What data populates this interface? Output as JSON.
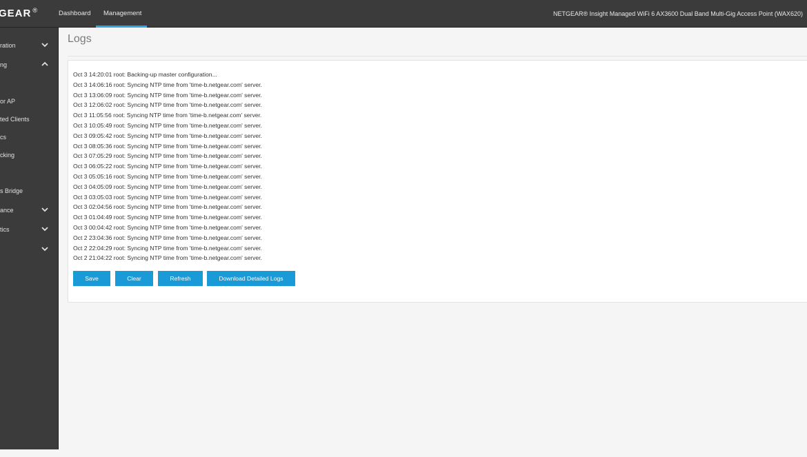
{
  "header": {
    "logo": "GEAR",
    "logo_mark": "®",
    "tabs": [
      "Dashboard",
      "Management"
    ],
    "active_tab": "Management",
    "product": "NETGEAR® Insight Managed WiFi 6 AX3600 Dual Band Multi-Gig Access Point (WAX620)",
    "accent_color": "#2ea6e6"
  },
  "sidebar": {
    "items": [
      {
        "label": "ration",
        "chevron": "down"
      },
      {
        "label": "ng",
        "chevron": "up"
      },
      {
        "label": "or AP",
        "chevron": ""
      },
      {
        "label": "ted Clients",
        "chevron": ""
      },
      {
        "label": "cs",
        "chevron": ""
      },
      {
        "label": "cking",
        "chevron": ""
      },
      {
        "label": "s Bridge",
        "chevron": ""
      },
      {
        "label": "ance",
        "chevron": "down"
      },
      {
        "label": "tics",
        "chevron": "down"
      },
      {
        "label": "",
        "chevron": "down"
      }
    ]
  },
  "page": {
    "title": "Logs"
  },
  "logs": [
    "Oct 3 14:20:01 root: Backing-up master configuration...",
    "Oct 3 14:06:16 root: Syncing NTP time from 'time-b.netgear.com' server.",
    "Oct 3 13:06:09 root: Syncing NTP time from 'time-b.netgear.com' server.",
    "Oct 3 12:06:02 root: Syncing NTP time from 'time-b.netgear.com' server.",
    "Oct 3 11:05:56 root: Syncing NTP time from 'time-b.netgear.com' server.",
    "Oct 3 10:05:49 root: Syncing NTP time from 'time-b.netgear.com' server.",
    "Oct 3 09:05:42 root: Syncing NTP time from 'time-b.netgear.com' server.",
    "Oct 3 08:05:36 root: Syncing NTP time from 'time-b.netgear.com' server.",
    "Oct 3 07:05:29 root: Syncing NTP time from 'time-b.netgear.com' server.",
    "Oct 3 06:05:22 root: Syncing NTP time from 'time-b.netgear.com' server.",
    "Oct 3 05:05:16 root: Syncing NTP time from 'time-b.netgear.com' server.",
    "Oct 3 04:05:09 root: Syncing NTP time from 'time-b.netgear.com' server.",
    "Oct 3 03:05:03 root: Syncing NTP time from 'time-b.netgear.com' server.",
    "Oct 3 02:04:56 root: Syncing NTP time from 'time-b.netgear.com' server.",
    "Oct 3 01:04:49 root: Syncing NTP time from 'time-b.netgear.com' server.",
    "Oct 3 00:04:42 root: Syncing NTP time from 'time-b.netgear.com' server.",
    "Oct 2 23:04:36 root: Syncing NTP time from 'time-b.netgear.com' server.",
    "Oct 2 22:04:29 root: Syncing NTP time from 'time-b.netgear.com' server.",
    "Oct 2 21:04:22 root: Syncing NTP time from 'time-b.netgear.com' server."
  ],
  "buttons": {
    "save": "Save",
    "clear": "Clear",
    "refresh": "Refresh",
    "download": "Download Detailed Logs",
    "color": "#1a9ad6"
  }
}
